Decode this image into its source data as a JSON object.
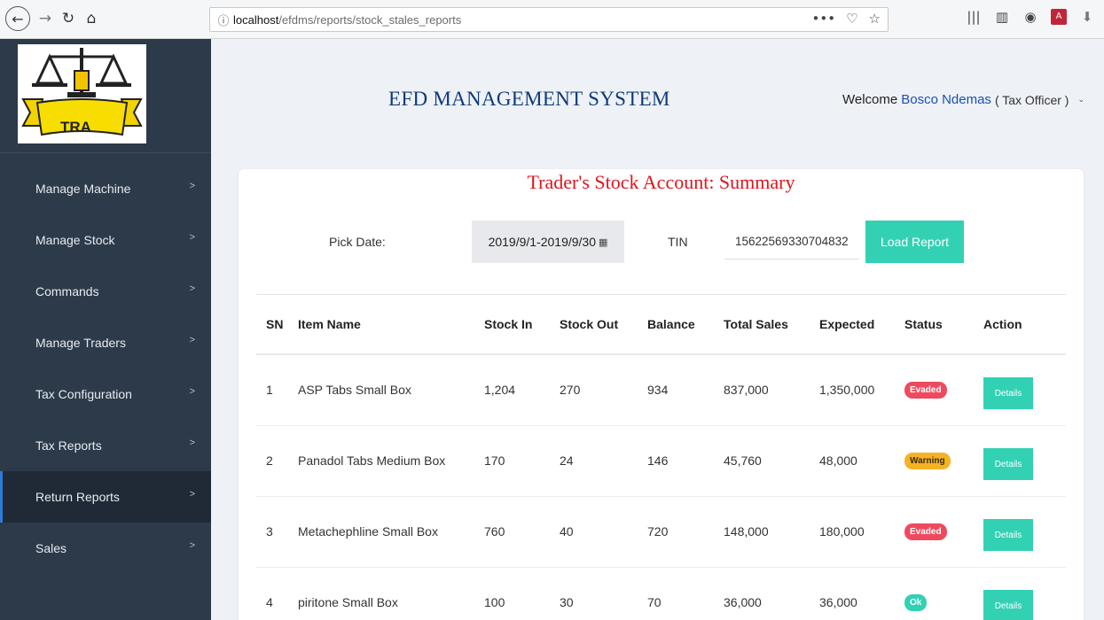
{
  "browser": {
    "url_host": "localhost",
    "url_path": "/efdms/reports/stock_stales_reports",
    "url_actions": [
      "•••",
      "☐",
      "☆"
    ]
  },
  "sidebar": {
    "logo_text": "TRA",
    "items": [
      {
        "label": "Manage Machine",
        "active": false
      },
      {
        "label": "Manage Stock",
        "active": false
      },
      {
        "label": "Commands",
        "active": false
      },
      {
        "label": "Manage Traders",
        "active": false
      },
      {
        "label": "Tax Configuration",
        "active": false
      },
      {
        "label": "Tax Reports",
        "active": false
      },
      {
        "label": "Return Reports",
        "active": true
      },
      {
        "label": "Sales",
        "active": false
      }
    ]
  },
  "header": {
    "title": "EFD MANAGEMENT SYSTEM",
    "welcome_prefix": "Welcome",
    "user_name": "Bosco Ndemas",
    "user_role": "( Tax Officer )"
  },
  "report": {
    "title": "Trader's Stock Account: Summary",
    "pick_date_label": "Pick Date:",
    "date_range": "2019/9/1-2019/9/30",
    "tin_label": "TIN",
    "tin_value": "15622569330704832",
    "load_button": "Load Report",
    "columns": [
      "SN",
      "Item Name",
      "Stock In",
      "Stock Out",
      "Balance",
      "Total Sales",
      "Expected",
      "Status",
      "Action"
    ],
    "rows": [
      {
        "sn": "1",
        "item": "ASP Tabs Small Box",
        "stock_in": "1,204",
        "stock_out": "270",
        "balance": "934",
        "total_sales": "837,000",
        "expected": "1,350,000",
        "status": "Evaded",
        "action": "Details"
      },
      {
        "sn": "2",
        "item": "Panadol Tabs Medium Box",
        "stock_in": "170",
        "stock_out": "24",
        "balance": "146",
        "total_sales": "45,760",
        "expected": "48,000",
        "status": "Warning",
        "action": "Details"
      },
      {
        "sn": "3",
        "item": "Metachephline Small Box",
        "stock_in": "760",
        "stock_out": "40",
        "balance": "720",
        "total_sales": "148,000",
        "expected": "180,000",
        "status": "Evaded",
        "action": "Details"
      },
      {
        "sn": "4",
        "item": "piritone Small Box",
        "stock_in": "100",
        "stock_out": "30",
        "balance": "70",
        "total_sales": "36,000",
        "expected": "36,000",
        "status": "Ok",
        "action": "Details"
      }
    ]
  },
  "colors": {
    "sidebar_bg": "#2c3a4a",
    "accent_teal": "#33d1b4",
    "title_red": "#e0141e",
    "system_title_blue": "#0c3a7c",
    "evaded_red": "#ee4a5f",
    "warning_orange": "#f5b324"
  }
}
